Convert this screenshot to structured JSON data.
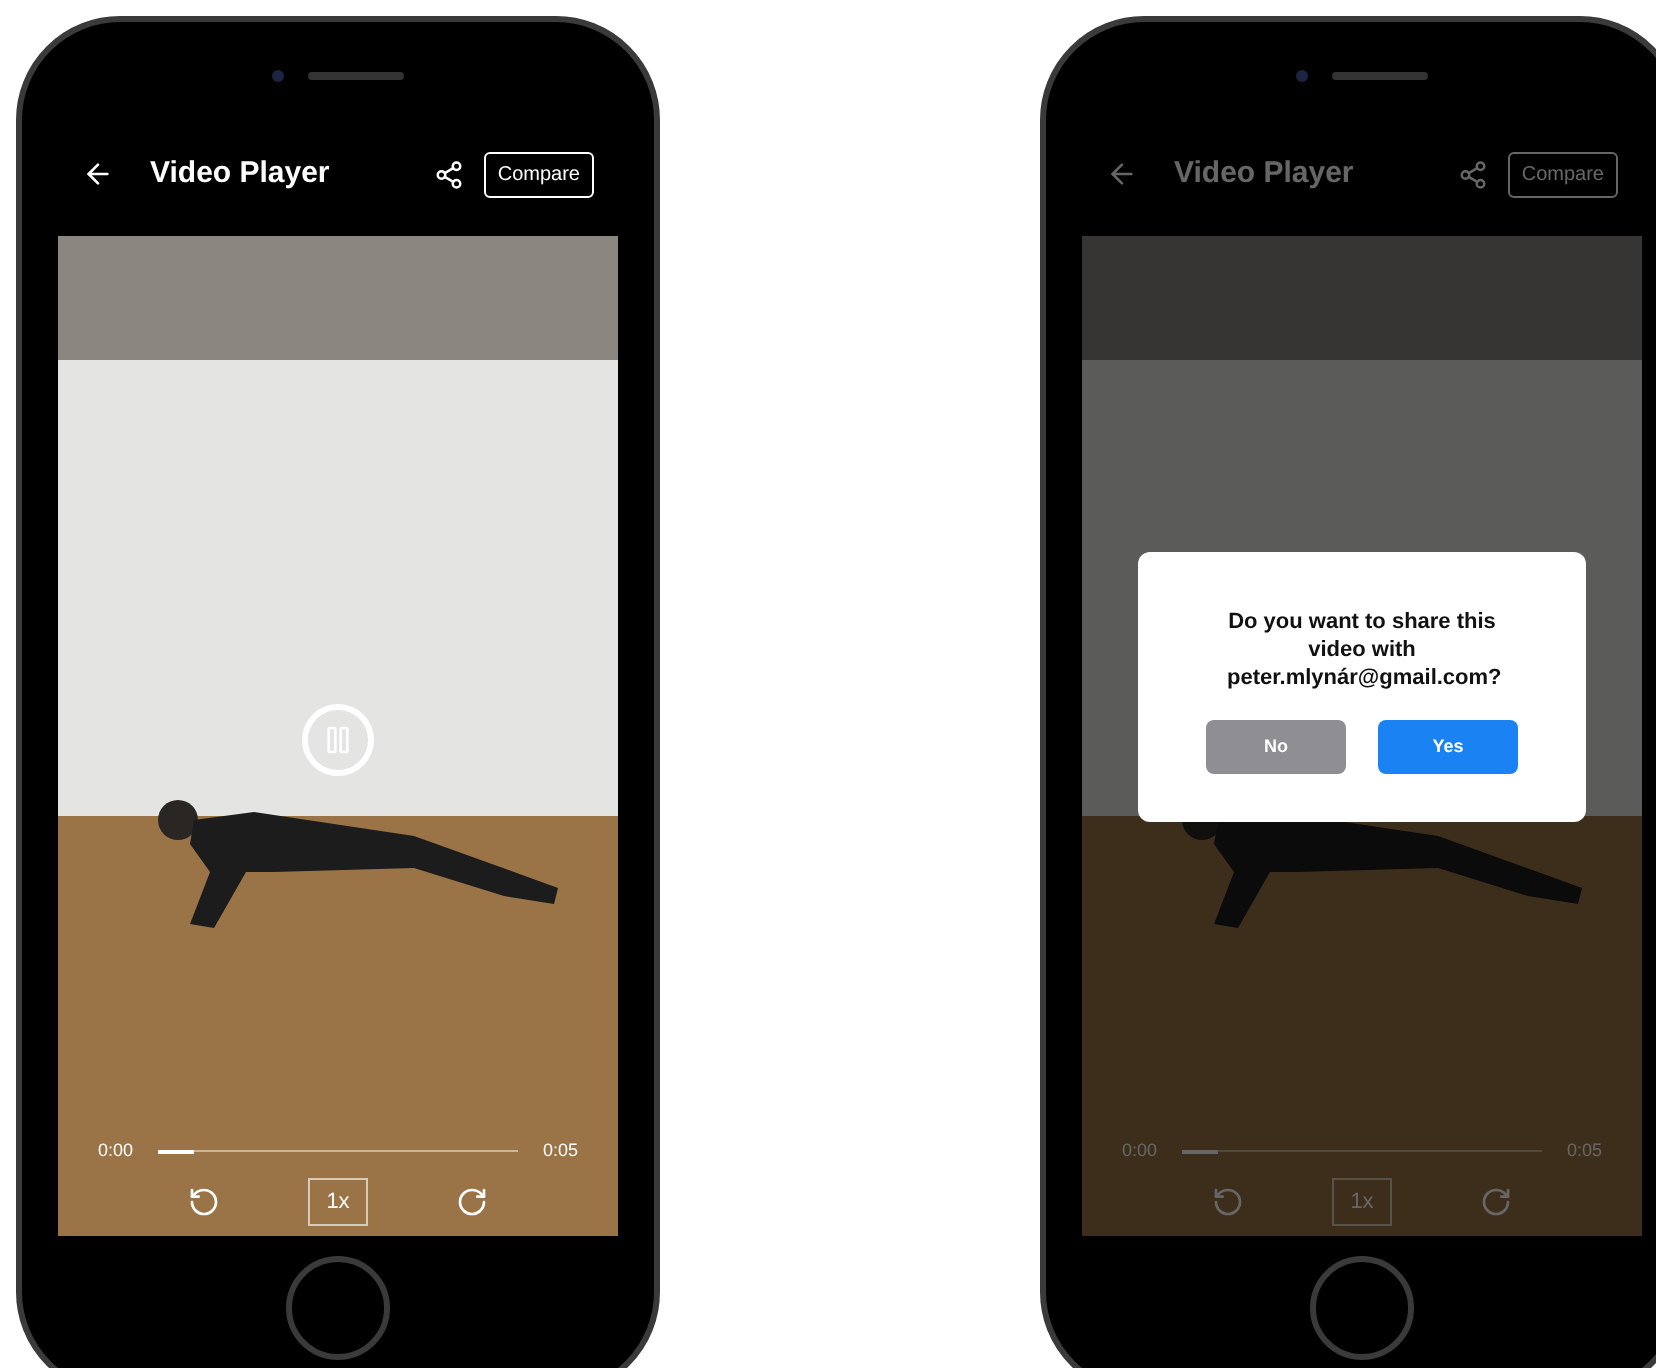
{
  "phones": [
    {
      "dimmed": false,
      "header": {
        "title": "Video Player",
        "compare_button": "Compare"
      },
      "player": {
        "playing": true,
        "time_current": "0:00",
        "time_total": "0:05",
        "level": 0.1,
        "speed": "1x"
      }
    },
    {
      "dimmed": true,
      "header": {
        "title": "Video Player",
        "compare_button": "Compare"
      },
      "player": {
        "time_current": "0:00",
        "time_total": "0:05",
        "level": 0.1,
        "speed": "1x"
      },
      "dialog": {
        "message": "Do you want to share this video with peter.mlynár@gmail.com?",
        "buttons": [
          {
            "label": "No",
            "kind": "secondary"
          },
          {
            "label": "Yes",
            "kind": "primary"
          }
        ]
      }
    }
  ]
}
